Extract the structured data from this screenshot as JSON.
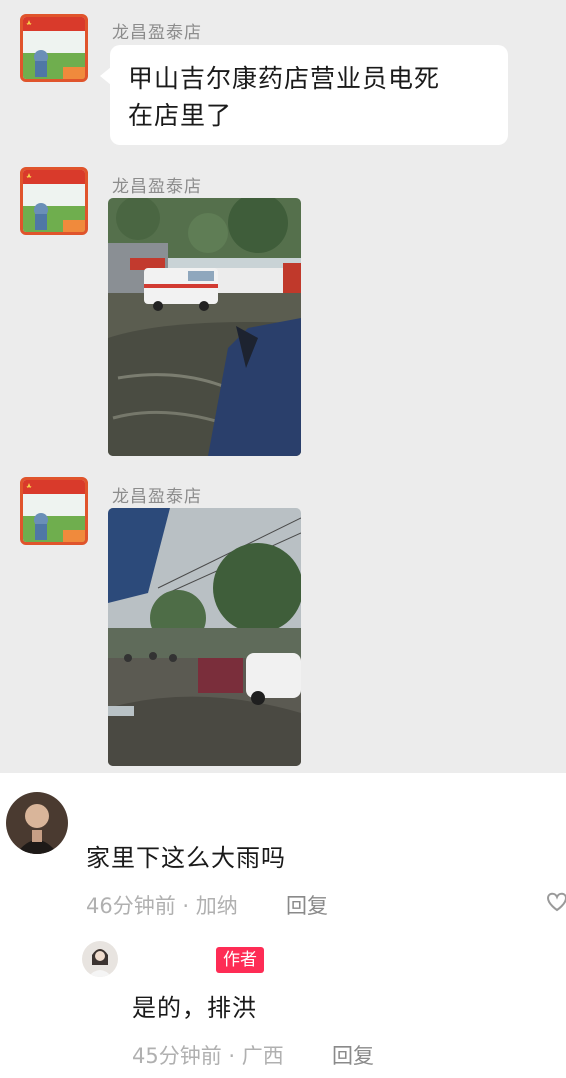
{
  "chat": {
    "messages": [
      {
        "sender": "龙昌盈泰店",
        "type": "text",
        "text_line1": "甲山吉尔康药店营业员电死",
        "text_line2": "在店里了"
      },
      {
        "sender": "龙昌盈泰店",
        "type": "image",
        "image": "flooded-street-with-ambulance-photo"
      },
      {
        "sender": "龙昌盈泰店",
        "type": "image",
        "image": "flooded-street-with-parked-cars-photo"
      }
    ]
  },
  "comments": {
    "main": {
      "text": "家里下这么大雨吗",
      "meta": "46分钟前 · 加纳",
      "reply_label": "回复",
      "like_icon": "heart-outline-icon"
    },
    "reply": {
      "badge": "作者",
      "text": "是的，排洪",
      "meta": "45分钟前 · 广西",
      "reply_label": "回复"
    }
  },
  "colors": {
    "chat_background": "#ececec",
    "bubble": "#ffffff",
    "author_badge": "#fe2c55",
    "meta_text": "#b0b0b0"
  }
}
